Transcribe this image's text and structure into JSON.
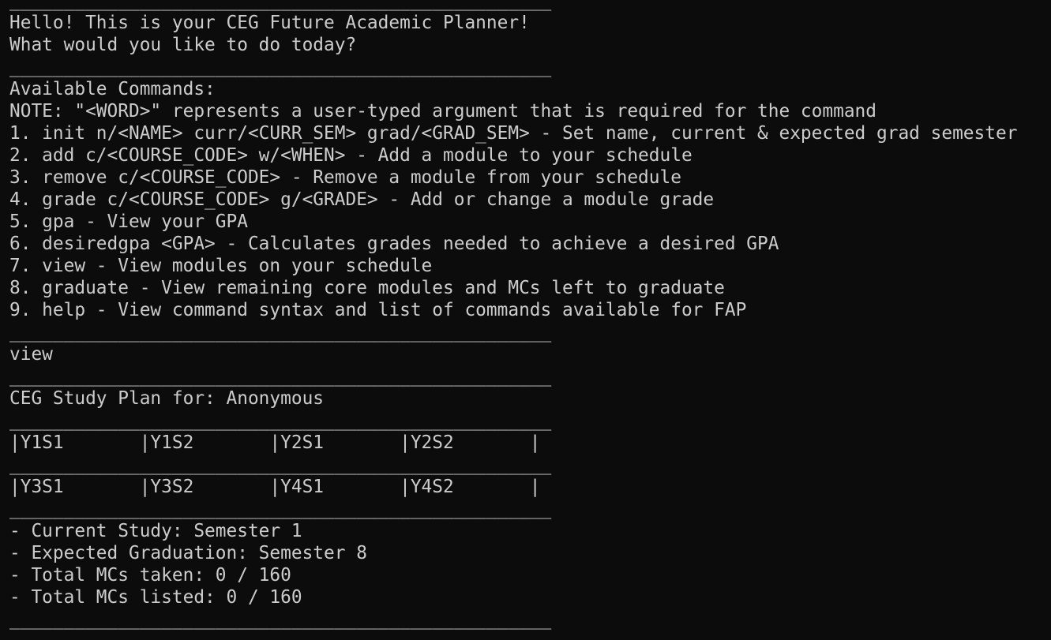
{
  "terminal": {
    "lines": [
      "__________________________________________________",
      "Hello! This is your CEG Future Academic Planner!",
      "What would you like to do today?",
      "__________________________________________________",
      "Available Commands:",
      "NOTE: \"<WORD>\" represents a user-typed argument that is required for the command",
      "1. init n/<NAME> curr/<CURR_SEM> grad/<GRAD_SEM> - Set name, current & expected grad semester",
      "2. add c/<COURSE_CODE> w/<WHEN> - Add a module to your schedule",
      "3. remove c/<COURSE_CODE> - Remove a module from your schedule",
      "4. grade c/<COURSE_CODE> g/<GRADE> - Add or change a module grade",
      "5. gpa - View your GPA",
      "6. desiredgpa <GPA> - Calculates grades needed to achieve a desired GPA",
      "7. view - View modules on your schedule",
      "8. graduate - View remaining core modules and MCs left to graduate",
      "9. help - View command syntax and list of commands available for FAP",
      "__________________________________________________",
      "view",
      "__________________________________________________",
      "CEG Study Plan for: Anonymous",
      "__________________________________________________",
      "|Y1S1       |Y1S2       |Y2S1       |Y2S2       |",
      "__________________________________________________",
      "|Y3S1       |Y3S2       |Y4S1       |Y4S2       |",
      "__________________________________________________",
      "- Current Study: Semester 1",
      "- Expected Graduation: Semester 8",
      "- Total MCs taken: 0 / 160",
      "- Total MCs listed: 0 / 160",
      "__________________________________________________"
    ]
  }
}
